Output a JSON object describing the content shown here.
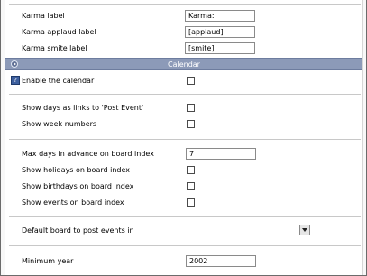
{
  "karma": {
    "label_label": "Karma label",
    "label_value": "Karma:",
    "applaud_label": "Karma applaud label",
    "applaud_value": "[applaud]",
    "smite_label": "Karma smite label",
    "smite_value": "[smite]"
  },
  "calendar_section": {
    "title": "Calendar",
    "enable_label": "Enable the calendar",
    "enable_checked": false,
    "show_days_links_label": "Show days as links to 'Post Event'",
    "show_days_links_checked": false,
    "show_week_numbers_label": "Show week numbers",
    "show_week_numbers_checked": false,
    "max_days_label": "Max days in advance on board index",
    "max_days_value": "7",
    "show_holidays_label": "Show holidays on board index",
    "show_holidays_checked": false,
    "show_birthdays_label": "Show birthdays on board index",
    "show_birthdays_checked": false,
    "show_events_label": "Show events on board index",
    "show_events_checked": false,
    "default_board_label": "Default board to post events in",
    "default_board_value": "",
    "min_year_label": "Minimum year",
    "min_year_value": "2002"
  },
  "colors": {
    "section_header_bg": "#8c9ab8",
    "section_header_text": "#ffffff"
  }
}
